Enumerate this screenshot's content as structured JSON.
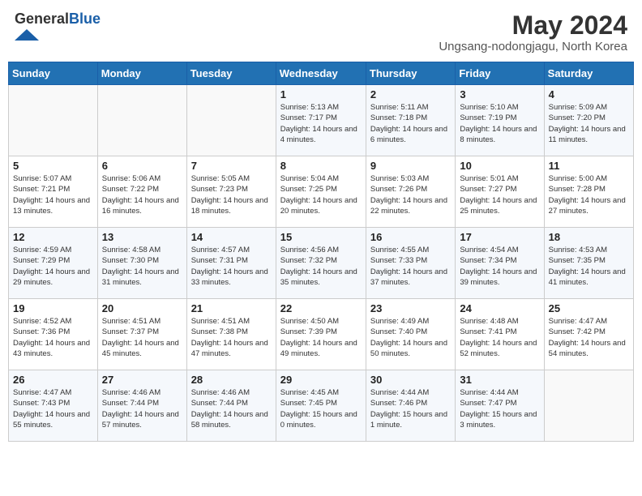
{
  "header": {
    "logo_general": "General",
    "logo_blue": "Blue",
    "month": "May 2024",
    "location": "Ungsang-nodongjagu, North Korea"
  },
  "weekdays": [
    "Sunday",
    "Monday",
    "Tuesday",
    "Wednesday",
    "Thursday",
    "Friday",
    "Saturday"
  ],
  "weeks": [
    [
      {
        "day": "",
        "sunrise": "",
        "sunset": "",
        "daylight": ""
      },
      {
        "day": "",
        "sunrise": "",
        "sunset": "",
        "daylight": ""
      },
      {
        "day": "",
        "sunrise": "",
        "sunset": "",
        "daylight": ""
      },
      {
        "day": "1",
        "sunrise": "Sunrise: 5:13 AM",
        "sunset": "Sunset: 7:17 PM",
        "daylight": "Daylight: 14 hours and 4 minutes."
      },
      {
        "day": "2",
        "sunrise": "Sunrise: 5:11 AM",
        "sunset": "Sunset: 7:18 PM",
        "daylight": "Daylight: 14 hours and 6 minutes."
      },
      {
        "day": "3",
        "sunrise": "Sunrise: 5:10 AM",
        "sunset": "Sunset: 7:19 PM",
        "daylight": "Daylight: 14 hours and 8 minutes."
      },
      {
        "day": "4",
        "sunrise": "Sunrise: 5:09 AM",
        "sunset": "Sunset: 7:20 PM",
        "daylight": "Daylight: 14 hours and 11 minutes."
      }
    ],
    [
      {
        "day": "5",
        "sunrise": "Sunrise: 5:07 AM",
        "sunset": "Sunset: 7:21 PM",
        "daylight": "Daylight: 14 hours and 13 minutes."
      },
      {
        "day": "6",
        "sunrise": "Sunrise: 5:06 AM",
        "sunset": "Sunset: 7:22 PM",
        "daylight": "Daylight: 14 hours and 16 minutes."
      },
      {
        "day": "7",
        "sunrise": "Sunrise: 5:05 AM",
        "sunset": "Sunset: 7:23 PM",
        "daylight": "Daylight: 14 hours and 18 minutes."
      },
      {
        "day": "8",
        "sunrise": "Sunrise: 5:04 AM",
        "sunset": "Sunset: 7:25 PM",
        "daylight": "Daylight: 14 hours and 20 minutes."
      },
      {
        "day": "9",
        "sunrise": "Sunrise: 5:03 AM",
        "sunset": "Sunset: 7:26 PM",
        "daylight": "Daylight: 14 hours and 22 minutes."
      },
      {
        "day": "10",
        "sunrise": "Sunrise: 5:01 AM",
        "sunset": "Sunset: 7:27 PM",
        "daylight": "Daylight: 14 hours and 25 minutes."
      },
      {
        "day": "11",
        "sunrise": "Sunrise: 5:00 AM",
        "sunset": "Sunset: 7:28 PM",
        "daylight": "Daylight: 14 hours and 27 minutes."
      }
    ],
    [
      {
        "day": "12",
        "sunrise": "Sunrise: 4:59 AM",
        "sunset": "Sunset: 7:29 PM",
        "daylight": "Daylight: 14 hours and 29 minutes."
      },
      {
        "day": "13",
        "sunrise": "Sunrise: 4:58 AM",
        "sunset": "Sunset: 7:30 PM",
        "daylight": "Daylight: 14 hours and 31 minutes."
      },
      {
        "day": "14",
        "sunrise": "Sunrise: 4:57 AM",
        "sunset": "Sunset: 7:31 PM",
        "daylight": "Daylight: 14 hours and 33 minutes."
      },
      {
        "day": "15",
        "sunrise": "Sunrise: 4:56 AM",
        "sunset": "Sunset: 7:32 PM",
        "daylight": "Daylight: 14 hours and 35 minutes."
      },
      {
        "day": "16",
        "sunrise": "Sunrise: 4:55 AM",
        "sunset": "Sunset: 7:33 PM",
        "daylight": "Daylight: 14 hours and 37 minutes."
      },
      {
        "day": "17",
        "sunrise": "Sunrise: 4:54 AM",
        "sunset": "Sunset: 7:34 PM",
        "daylight": "Daylight: 14 hours and 39 minutes."
      },
      {
        "day": "18",
        "sunrise": "Sunrise: 4:53 AM",
        "sunset": "Sunset: 7:35 PM",
        "daylight": "Daylight: 14 hours and 41 minutes."
      }
    ],
    [
      {
        "day": "19",
        "sunrise": "Sunrise: 4:52 AM",
        "sunset": "Sunset: 7:36 PM",
        "daylight": "Daylight: 14 hours and 43 minutes."
      },
      {
        "day": "20",
        "sunrise": "Sunrise: 4:51 AM",
        "sunset": "Sunset: 7:37 PM",
        "daylight": "Daylight: 14 hours and 45 minutes."
      },
      {
        "day": "21",
        "sunrise": "Sunrise: 4:51 AM",
        "sunset": "Sunset: 7:38 PM",
        "daylight": "Daylight: 14 hours and 47 minutes."
      },
      {
        "day": "22",
        "sunrise": "Sunrise: 4:50 AM",
        "sunset": "Sunset: 7:39 PM",
        "daylight": "Daylight: 14 hours and 49 minutes."
      },
      {
        "day": "23",
        "sunrise": "Sunrise: 4:49 AM",
        "sunset": "Sunset: 7:40 PM",
        "daylight": "Daylight: 14 hours and 50 minutes."
      },
      {
        "day": "24",
        "sunrise": "Sunrise: 4:48 AM",
        "sunset": "Sunset: 7:41 PM",
        "daylight": "Daylight: 14 hours and 52 minutes."
      },
      {
        "day": "25",
        "sunrise": "Sunrise: 4:47 AM",
        "sunset": "Sunset: 7:42 PM",
        "daylight": "Daylight: 14 hours and 54 minutes."
      }
    ],
    [
      {
        "day": "26",
        "sunrise": "Sunrise: 4:47 AM",
        "sunset": "Sunset: 7:43 PM",
        "daylight": "Daylight: 14 hours and 55 minutes."
      },
      {
        "day": "27",
        "sunrise": "Sunrise: 4:46 AM",
        "sunset": "Sunset: 7:44 PM",
        "daylight": "Daylight: 14 hours and 57 minutes."
      },
      {
        "day": "28",
        "sunrise": "Sunrise: 4:46 AM",
        "sunset": "Sunset: 7:44 PM",
        "daylight": "Daylight: 14 hours and 58 minutes."
      },
      {
        "day": "29",
        "sunrise": "Sunrise: 4:45 AM",
        "sunset": "Sunset: 7:45 PM",
        "daylight": "Daylight: 15 hours and 0 minutes."
      },
      {
        "day": "30",
        "sunrise": "Sunrise: 4:44 AM",
        "sunset": "Sunset: 7:46 PM",
        "daylight": "Daylight: 15 hours and 1 minute."
      },
      {
        "day": "31",
        "sunrise": "Sunrise: 4:44 AM",
        "sunset": "Sunset: 7:47 PM",
        "daylight": "Daylight: 15 hours and 3 minutes."
      },
      {
        "day": "",
        "sunrise": "",
        "sunset": "",
        "daylight": ""
      }
    ]
  ]
}
